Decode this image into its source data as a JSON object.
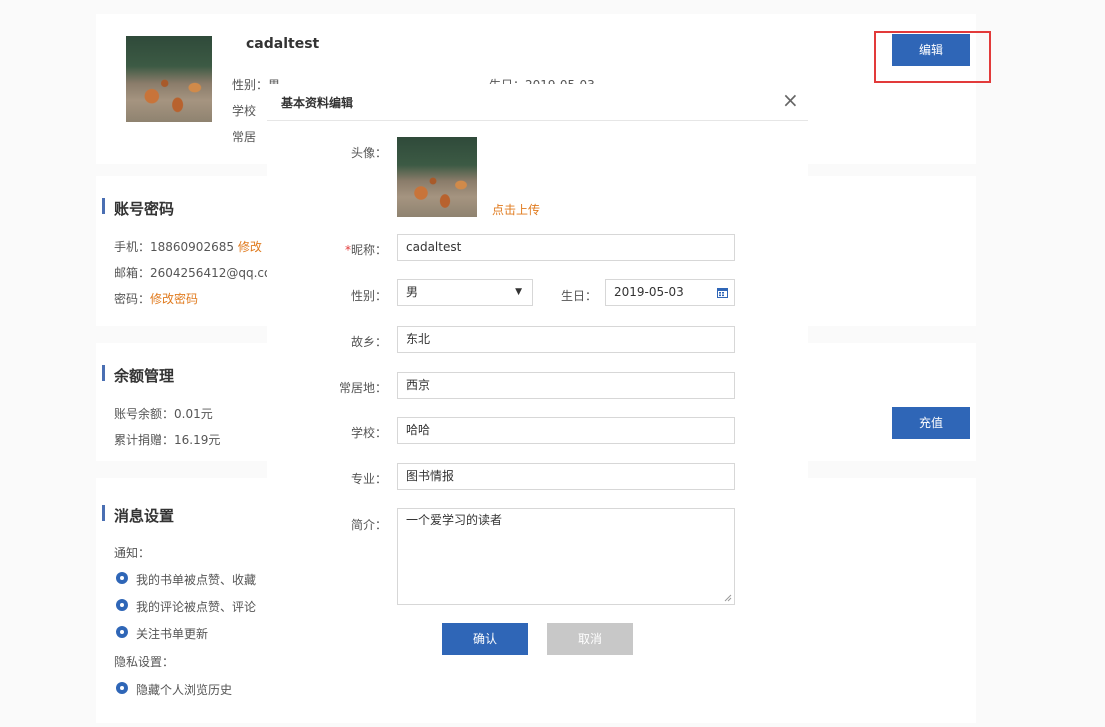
{
  "profile": {
    "name": "cadaltest",
    "gender_line": "性别：男",
    "birthday_line": "生日：2019-05-03",
    "school_line_prefix": "学校",
    "residence_line_prefix": "常居",
    "edit_button": "编辑"
  },
  "account": {
    "title": "账号密码",
    "phone_label": "手机：18860902685",
    "phone_action": "修改",
    "email_label": "邮箱：2604256412@qq.co",
    "password_label": "密码：",
    "password_action": "修改密码"
  },
  "balance": {
    "title": "余额管理",
    "balance_line": "账号余额：0.01元",
    "donation_line": "累计捐赠：16.19元",
    "recharge_button": "充值"
  },
  "messages": {
    "title": "消息设置",
    "notify_label": "通知：",
    "options": [
      {
        "label": "我的书单被点赞、收藏"
      },
      {
        "label": "我的评论被点赞、评论"
      },
      {
        "label": "关注书单更新"
      }
    ],
    "privacy_label": "隐私设置：",
    "privacy_options": [
      {
        "label": "隐藏个人浏览历史"
      }
    ]
  },
  "modal": {
    "title": "基本资料编辑",
    "close_glyph": "×",
    "avatar_label": "头像：",
    "upload_link": "点击上传",
    "nickname_required": "*",
    "nickname_label": "昵称：",
    "nickname_value": "cadaltest",
    "gender_label": "性别：",
    "gender_value": "男",
    "birthday_label": "生日：",
    "birthday_value": "2019-05-03",
    "hometown_label": "故乡：",
    "hometown_value": "东北",
    "residence_label": "常居地：",
    "residence_value": "西京",
    "school_label": "学校：",
    "school_value": "哈哈",
    "major_label": "专业：",
    "major_value": "图书情报",
    "bio_label": "简介：",
    "bio_value": "一个爱学习的读者",
    "confirm_button": "确认",
    "cancel_button": "取消"
  },
  "colors": {
    "accent": "#2f66b7",
    "link_orange": "#e07b1f",
    "required_red": "#e23a3a",
    "cancel_gray": "#c8c8c8"
  },
  "icons": {
    "dropdown": "caret-down-icon",
    "calendar": "calendar-icon",
    "close": "close-icon",
    "resize": "resize-grip-icon"
  }
}
